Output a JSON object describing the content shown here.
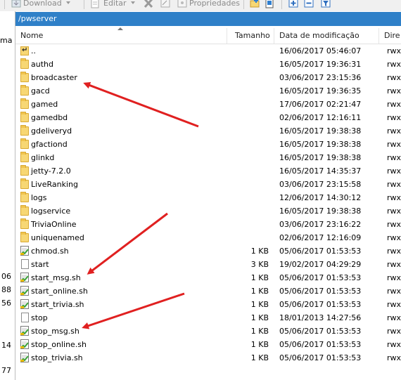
{
  "toolbar": {
    "download_label": "Download",
    "edit_label": "Editar",
    "properties_label": "Propriedades"
  },
  "left_pane": {
    "header_fragment": "ma",
    "fragments": [
      "06",
      "88",
      "56",
      "14",
      "77"
    ]
  },
  "path": "/pwserver",
  "columns": {
    "name": "Nome",
    "size": "Tamanho",
    "modified": "Data de modificação",
    "rights": "Dire"
  },
  "files": [
    {
      "name": "..",
      "size": "",
      "modified": "16/06/2017 05:46:07",
      "rights": "rwx",
      "icon": "parent-directory-icon"
    },
    {
      "name": "authd",
      "size": "",
      "modified": "16/05/2017 19:36:31",
      "rights": "rwx",
      "icon": "folder-icon"
    },
    {
      "name": "broadcaster",
      "size": "",
      "modified": "03/06/2017 23:15:36",
      "rights": "rwx",
      "icon": "folder-icon"
    },
    {
      "name": "gacd",
      "size": "",
      "modified": "16/05/2017 19:36:35",
      "rights": "rwx",
      "icon": "folder-icon"
    },
    {
      "name": "gamed",
      "size": "",
      "modified": "17/06/2017 02:21:47",
      "rights": "rwx",
      "icon": "folder-icon"
    },
    {
      "name": "gamedbd",
      "size": "",
      "modified": "02/06/2017 12:16:11",
      "rights": "rwx",
      "icon": "folder-icon"
    },
    {
      "name": "gdeliveryd",
      "size": "",
      "modified": "16/05/2017 19:38:38",
      "rights": "rwx",
      "icon": "folder-icon"
    },
    {
      "name": "gfactiond",
      "size": "",
      "modified": "16/05/2017 19:38:38",
      "rights": "rwx",
      "icon": "folder-icon"
    },
    {
      "name": "glinkd",
      "size": "",
      "modified": "16/05/2017 19:38:38",
      "rights": "rwx",
      "icon": "folder-icon"
    },
    {
      "name": "jetty-7.2.0",
      "size": "",
      "modified": "16/05/2017 14:35:37",
      "rights": "rwx",
      "icon": "folder-icon"
    },
    {
      "name": "LiveRanking",
      "size": "",
      "modified": "03/06/2017 23:15:58",
      "rights": "rwx",
      "icon": "folder-icon"
    },
    {
      "name": "logs",
      "size": "",
      "modified": "12/06/2017 14:30:12",
      "rights": "rwx",
      "icon": "folder-icon"
    },
    {
      "name": "logservice",
      "size": "",
      "modified": "16/05/2017 19:38:38",
      "rights": "rwx",
      "icon": "folder-icon"
    },
    {
      "name": "TriviaOnline",
      "size": "",
      "modified": "03/06/2017 23:16:22",
      "rights": "rwx",
      "icon": "folder-icon"
    },
    {
      "name": "uniquenamed",
      "size": "",
      "modified": "02/06/2017 12:16:09",
      "rights": "rwx",
      "icon": "folder-icon"
    },
    {
      "name": "chmod.sh",
      "size": "1 KB",
      "modified": "05/06/2017 01:53:53",
      "rights": "rwx",
      "icon": "shell-script-icon"
    },
    {
      "name": "start",
      "size": "3 KB",
      "modified": "19/02/2017 04:29:29",
      "rights": "rwx",
      "icon": "file-icon"
    },
    {
      "name": "start_msg.sh",
      "size": "1 KB",
      "modified": "05/06/2017 01:53:53",
      "rights": "rwx",
      "icon": "shell-script-icon"
    },
    {
      "name": "start_online.sh",
      "size": "1 KB",
      "modified": "05/06/2017 01:53:53",
      "rights": "rwx",
      "icon": "shell-script-icon"
    },
    {
      "name": "start_trivia.sh",
      "size": "1 KB",
      "modified": "05/06/2017 01:53:53",
      "rights": "rwx",
      "icon": "shell-script-icon"
    },
    {
      "name": "stop",
      "size": "1 KB",
      "modified": "18/01/2013 14:27:56",
      "rights": "rwx",
      "icon": "file-icon"
    },
    {
      "name": "stop_msg.sh",
      "size": "1 KB",
      "modified": "05/06/2017 01:53:53",
      "rights": "rwx",
      "icon": "shell-script-icon"
    },
    {
      "name": "stop_online.sh",
      "size": "1 KB",
      "modified": "05/06/2017 01:53:53",
      "rights": "rwx",
      "icon": "shell-script-icon"
    },
    {
      "name": "stop_trivia.sh",
      "size": "1 KB",
      "modified": "05/06/2017 01:53:53",
      "rights": "rwx",
      "icon": "shell-script-icon"
    }
  ],
  "colors": {
    "path_bar": "#2f80c8",
    "folder": "#f7d774",
    "annotation_arrow": "#e02020"
  }
}
